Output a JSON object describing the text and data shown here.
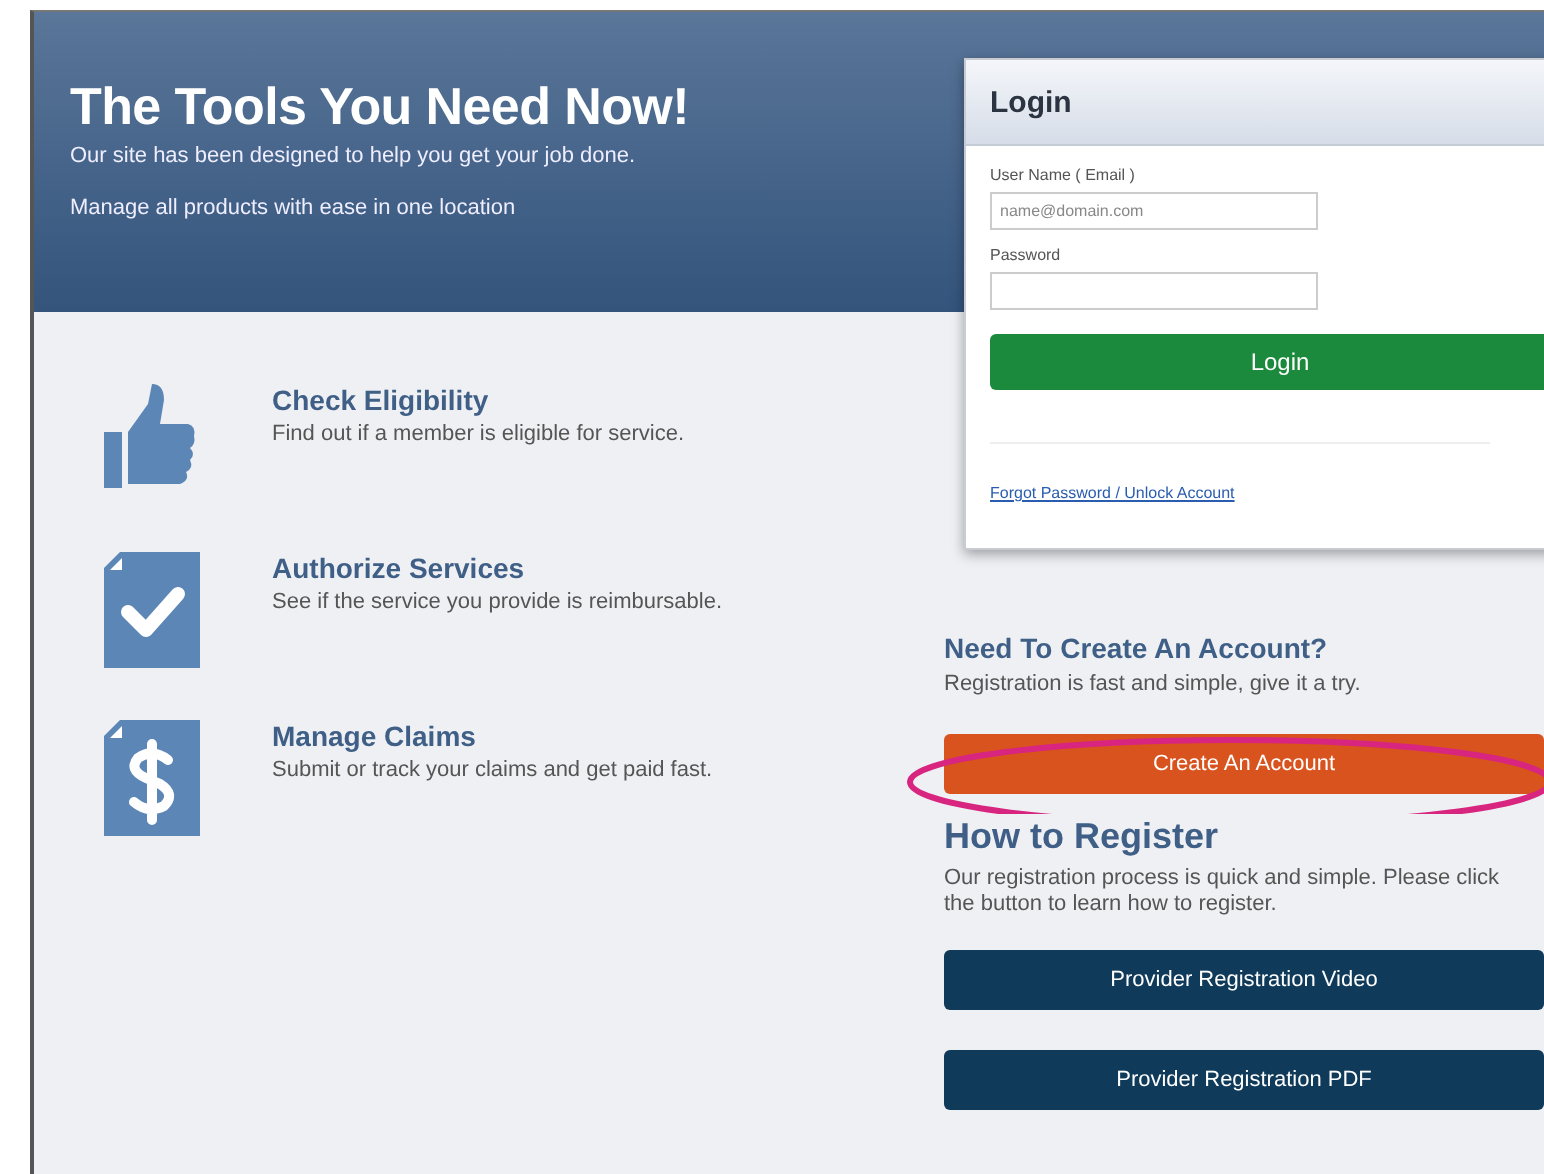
{
  "header": {
    "title": "The Tools You Need Now!",
    "lines": [
      "Our site has been designed to help you get your job done.",
      "Manage all products with ease in one location"
    ]
  },
  "login": {
    "title": "Login",
    "username_label": "User Name ( Email )",
    "username_placeholder": "name@domain.com",
    "password_label": "Password",
    "button": "Login",
    "link": "Forgot Password / Unlock Account"
  },
  "features": [
    {
      "kind": "thumb",
      "title": "Check Eligibility",
      "text": "Find out if a member is eligible for service."
    },
    {
      "kind": "check",
      "title": "Authorize Services",
      "text": "See if the service you provide is reimbursable."
    },
    {
      "kind": "dollar",
      "title": "Manage Claims",
      "text": "Submit or track your claims and get paid fast."
    }
  ],
  "account": {
    "title": "Need To Create An Account?",
    "text": "Registration is fast and simple, give it a try.",
    "button": "Create An Account",
    "highlighted": true
  },
  "register": {
    "title": "How to Register",
    "text": "Our registration process is quick and simple. Please click the button to learn how to register.",
    "buttons": [
      "Provider Registration Video",
      "Provider Registration PDF"
    ]
  }
}
